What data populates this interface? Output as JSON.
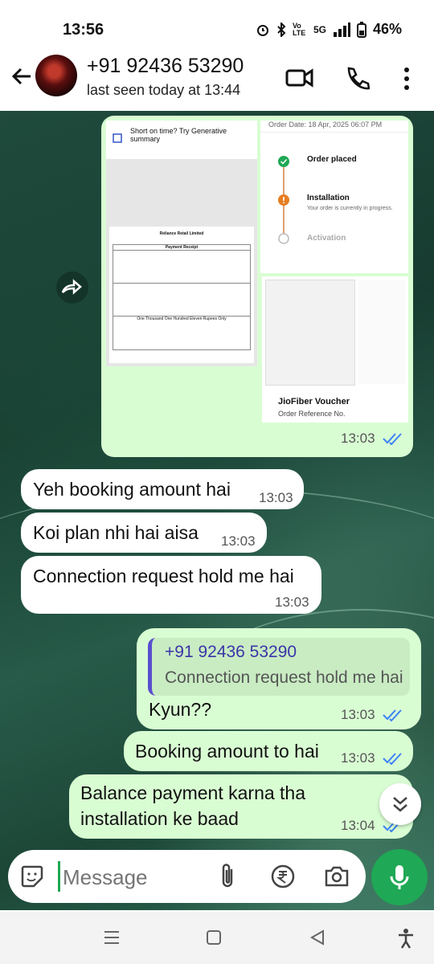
{
  "status_bar": {
    "time": "13:56",
    "network": "5G",
    "volte": "Vo LTE",
    "battery": "46%"
  },
  "header": {
    "contact_name": "+91 92436 53290",
    "last_seen": "last seen today at 13:44"
  },
  "media": {
    "doc1_banner": "Short on time? Try Generative summary",
    "doc1_company": "Reliance Retail Limited",
    "doc1_heading": "Payment Receipt",
    "doc1_amount_words": "One Thousand One Hundred Eleven Rupees Only",
    "doc2_order_date": "Order Date: 18 Apr, 2025 06:07 PM",
    "doc2_step1": "Order placed",
    "doc2_step2": "Installation",
    "doc2_step2_sub": "Your order is currently in progress.",
    "doc2_step3": "Activation",
    "doc3_title": "JioFiber Voucher",
    "doc3_sub": "Order Reference No.",
    "time": "13:03"
  },
  "messages": [
    {
      "dir": "in",
      "text": "Yeh booking amount hai",
      "time": "13:03"
    },
    {
      "dir": "in",
      "text": "Koi plan nhi hai aisa",
      "time": "13:03"
    },
    {
      "dir": "in",
      "text": "Connection request hold me hai",
      "time": "13:03"
    },
    {
      "dir": "out",
      "reply_to_name": "+91 92436 53290",
      "reply_to_text": "Connection request hold me hai",
      "text": "Kyun??",
      "time": "13:03"
    },
    {
      "dir": "out",
      "text": "Booking amount to hai",
      "time": "13:03"
    },
    {
      "dir": "out",
      "text_line1": "Balance payment karna tha",
      "text_line2": "installation ke baad",
      "time": "13:04"
    }
  ],
  "composer": {
    "placeholder": "Message"
  },
  "colors": {
    "out_bubble": "#d9fdd3",
    "accent_green": "#1fa855",
    "read_ticks": "#3b82f6"
  },
  "icons": [
    "back-arrow-icon",
    "video-call-icon",
    "phone-icon",
    "more-vert-icon",
    "forward-icon",
    "sticker-icon",
    "attach-icon",
    "rupee-icon",
    "camera-icon",
    "mic-icon",
    "scroll-down-icon"
  ]
}
